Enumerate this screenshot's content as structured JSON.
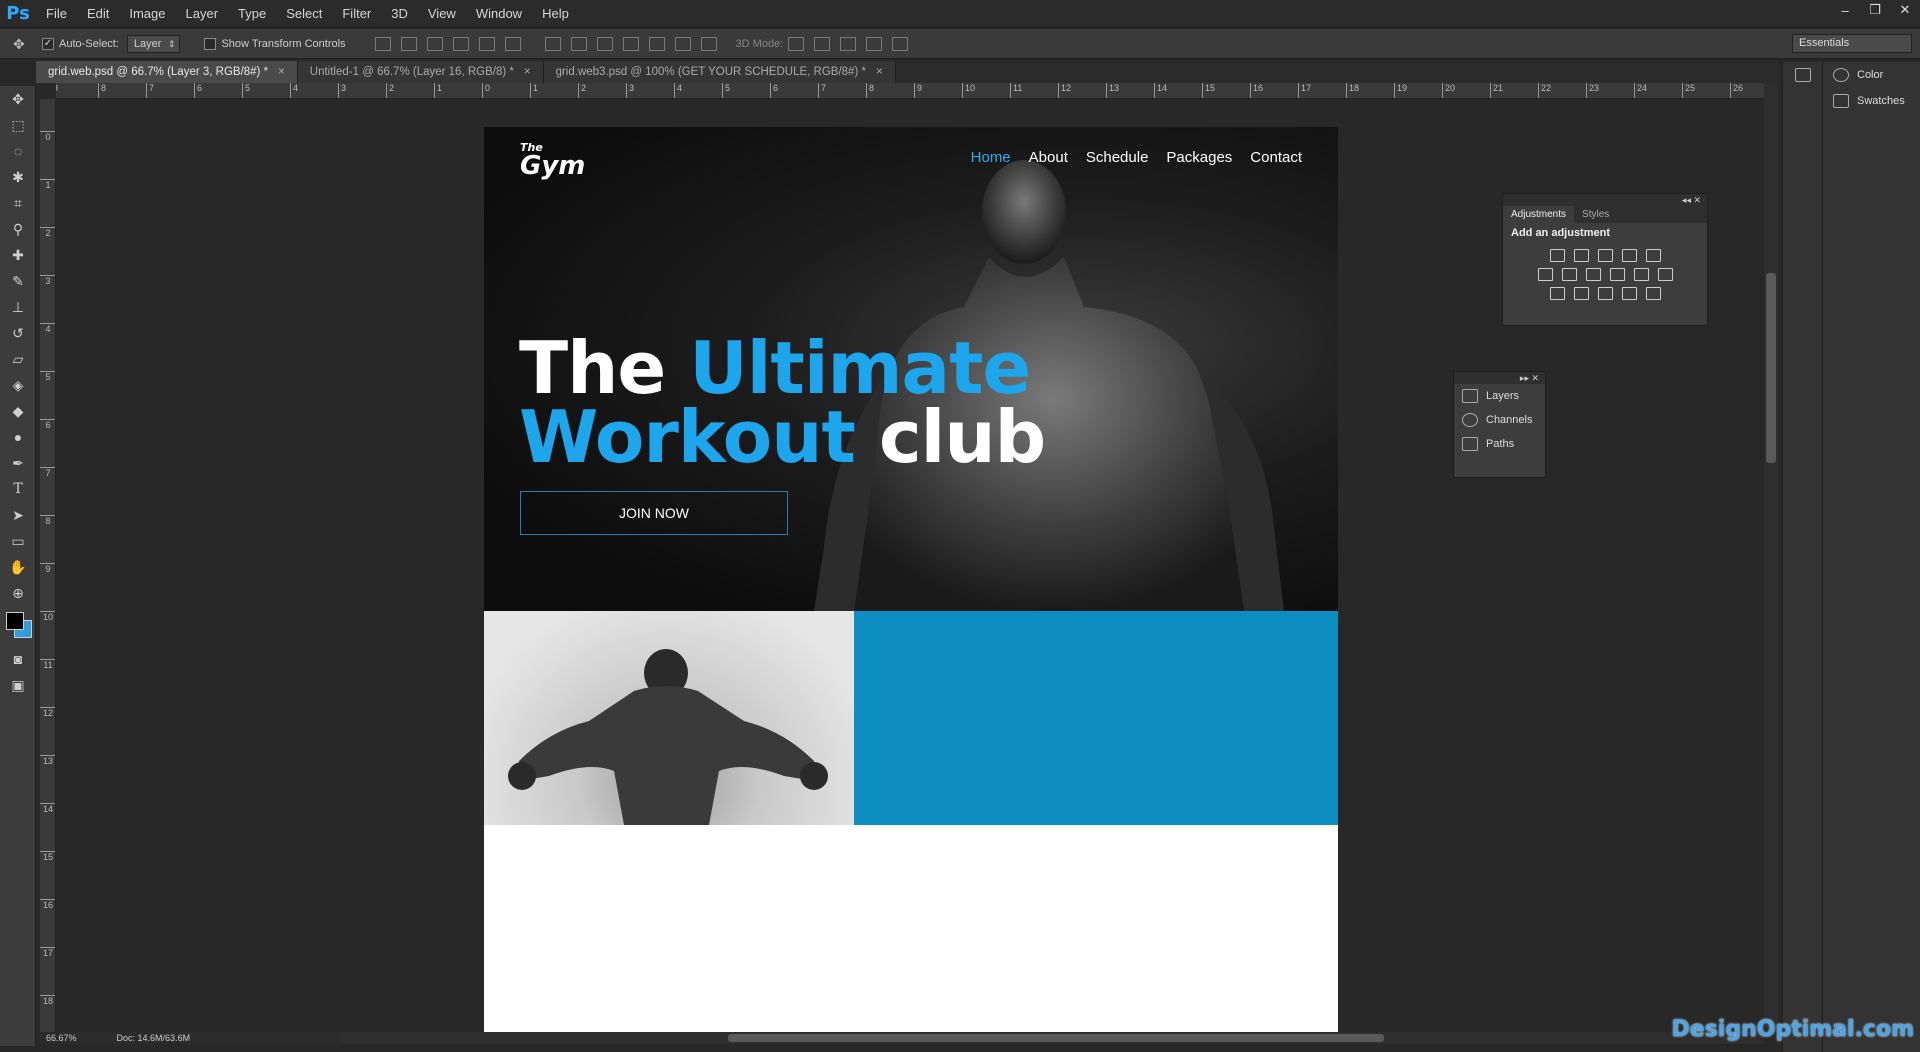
{
  "app": {
    "logo": "Ps"
  },
  "menu": [
    "File",
    "Edit",
    "Image",
    "Layer",
    "Type",
    "Select",
    "Filter",
    "3D",
    "View",
    "Window",
    "Help"
  ],
  "window_controls": [
    "–",
    "❐",
    "✕"
  ],
  "options": {
    "auto_select_label": "Auto-Select:",
    "auto_select_value": "Layer",
    "show_transform_label": "Show Transform Controls",
    "mode_3d_label": "3D Mode:",
    "workspace": "Essentials"
  },
  "tabs": [
    {
      "label": "grid.web.psd @ 66.7% (Layer 3, RGB/8#) *",
      "close": "×"
    },
    {
      "label": "Untitled-1 @ 66.7% (Layer 16, RGB/8) *",
      "close": "×"
    },
    {
      "label": "grid.web3.psd @ 100% (GET YOUR SCHEDULE, RGB/8#) *",
      "close": "×"
    }
  ],
  "ruler_h": [
    "9",
    "8",
    "7",
    "6",
    "5",
    "4",
    "3",
    "2",
    "1",
    "0",
    "1",
    "2",
    "3",
    "4",
    "5",
    "6",
    "7",
    "8",
    "9",
    "10",
    "11",
    "12",
    "13",
    "14",
    "15",
    "16",
    "17",
    "18",
    "19",
    "20",
    "21",
    "22",
    "23",
    "24",
    "25",
    "26"
  ],
  "ruler_v": [
    "0",
    "1",
    "2",
    "3",
    "4",
    "5",
    "6",
    "7",
    "8",
    "9",
    "10",
    "11",
    "12",
    "13",
    "14",
    "15",
    "16",
    "17",
    "18"
  ],
  "site": {
    "logo_small": "The",
    "logo_big": "Gym",
    "nav": [
      "Home",
      "About",
      "Schedule",
      "Packages",
      "Contact"
    ],
    "headline_1_white": "The ",
    "headline_1_blue": "Ultimate",
    "headline_2_blue": "Workout",
    "headline_2_white": " club",
    "cta": "JOIN NOW"
  },
  "adjustments": {
    "tabs": [
      "Adjustments",
      "Styles"
    ],
    "title": "Add an adjustment",
    "collapse": "◂◂ ✕"
  },
  "layers_panel": {
    "collapse": "▸▸ ✕",
    "items": [
      "Layers",
      "Channels",
      "Paths"
    ]
  },
  "dock": {
    "items": [
      "Color",
      "Swatches"
    ]
  },
  "status": {
    "zoom": "66.67%",
    "doc": "Doc: 14.6M/63.6M"
  },
  "watermark": "DesignOptimal.com",
  "colors": {
    "accent": "#1da6ec",
    "panel_blue": "#0c8ec2"
  }
}
